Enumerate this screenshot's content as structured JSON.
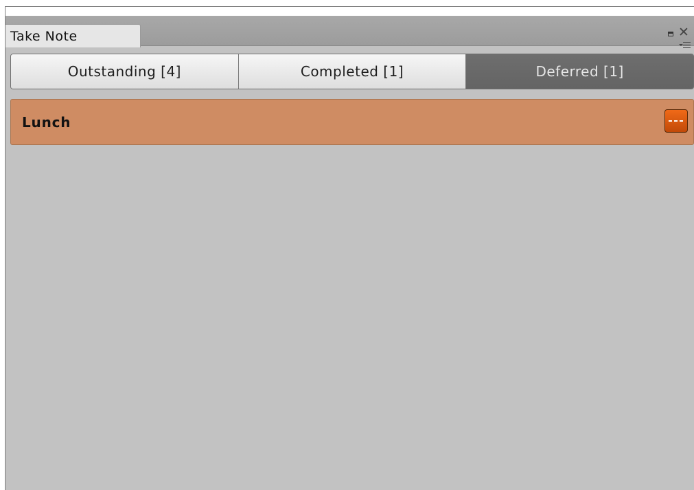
{
  "window": {
    "title": "Take Note"
  },
  "tabs": [
    {
      "label": "Outstanding [4]",
      "active": false
    },
    {
      "label": "Completed [1]",
      "active": false
    },
    {
      "label": "Deferred [1]",
      "active": true
    }
  ],
  "items": [
    {
      "title": "Lunch",
      "color": "#cf8c63"
    }
  ],
  "colors": {
    "panel_bg": "#c2c2c2",
    "active_tab": "#6b6b6b",
    "item_bg": "#cf8c63",
    "more_button": "#e05c10"
  },
  "icons": {
    "maximize": "maximize-icon",
    "close": "close-icon",
    "menu": "menu-icon",
    "more": "more-icon"
  }
}
